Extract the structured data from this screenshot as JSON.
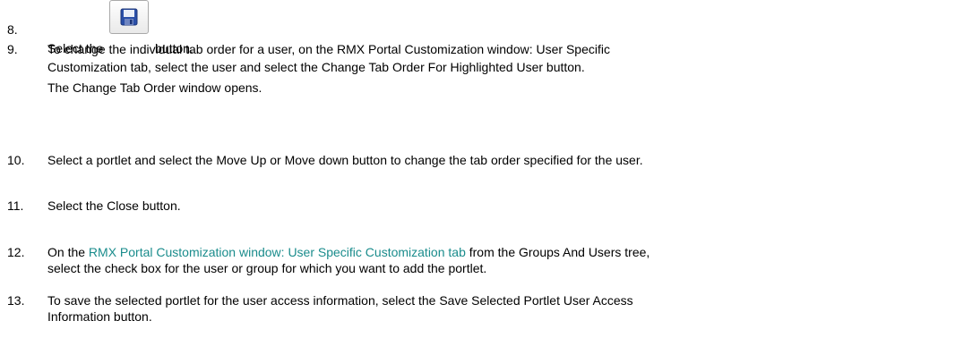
{
  "steps": [
    {
      "num": "8.",
      "before": "Select the",
      "after": "button.",
      "icon": "save-disk-icon"
    },
    {
      "num": "9.",
      "lines": [
        "To change the individual tab order for a user, on the RMX Portal Customization window: User Specific",
        "Customization tab, select the user and select the Change Tab Order For Highlighted User button."
      ],
      "note": "The Change Tab Order window opens."
    },
    {
      "num": "10.",
      "text": "Select a portlet and select the Move Up or Move down button to change the  tab order specified for the user."
    },
    {
      "num": "11.",
      "text": "Select the Close button."
    },
    {
      "num": "12.",
      "prefix": "On the ",
      "link": "RMX Portal Customization window: User Specific Customization tab",
      "suffix": " from the Groups And Users tree,",
      "line2": "select the check box for the user or group for which you want to add the portlet."
    },
    {
      "num": "13.",
      "lines": [
        "To save the selected portlet for the user access information, select the Save Selected Portlet User Access",
        "Information button."
      ]
    }
  ],
  "colors": {
    "link": "#1a8c8c",
    "text": "#000000"
  }
}
